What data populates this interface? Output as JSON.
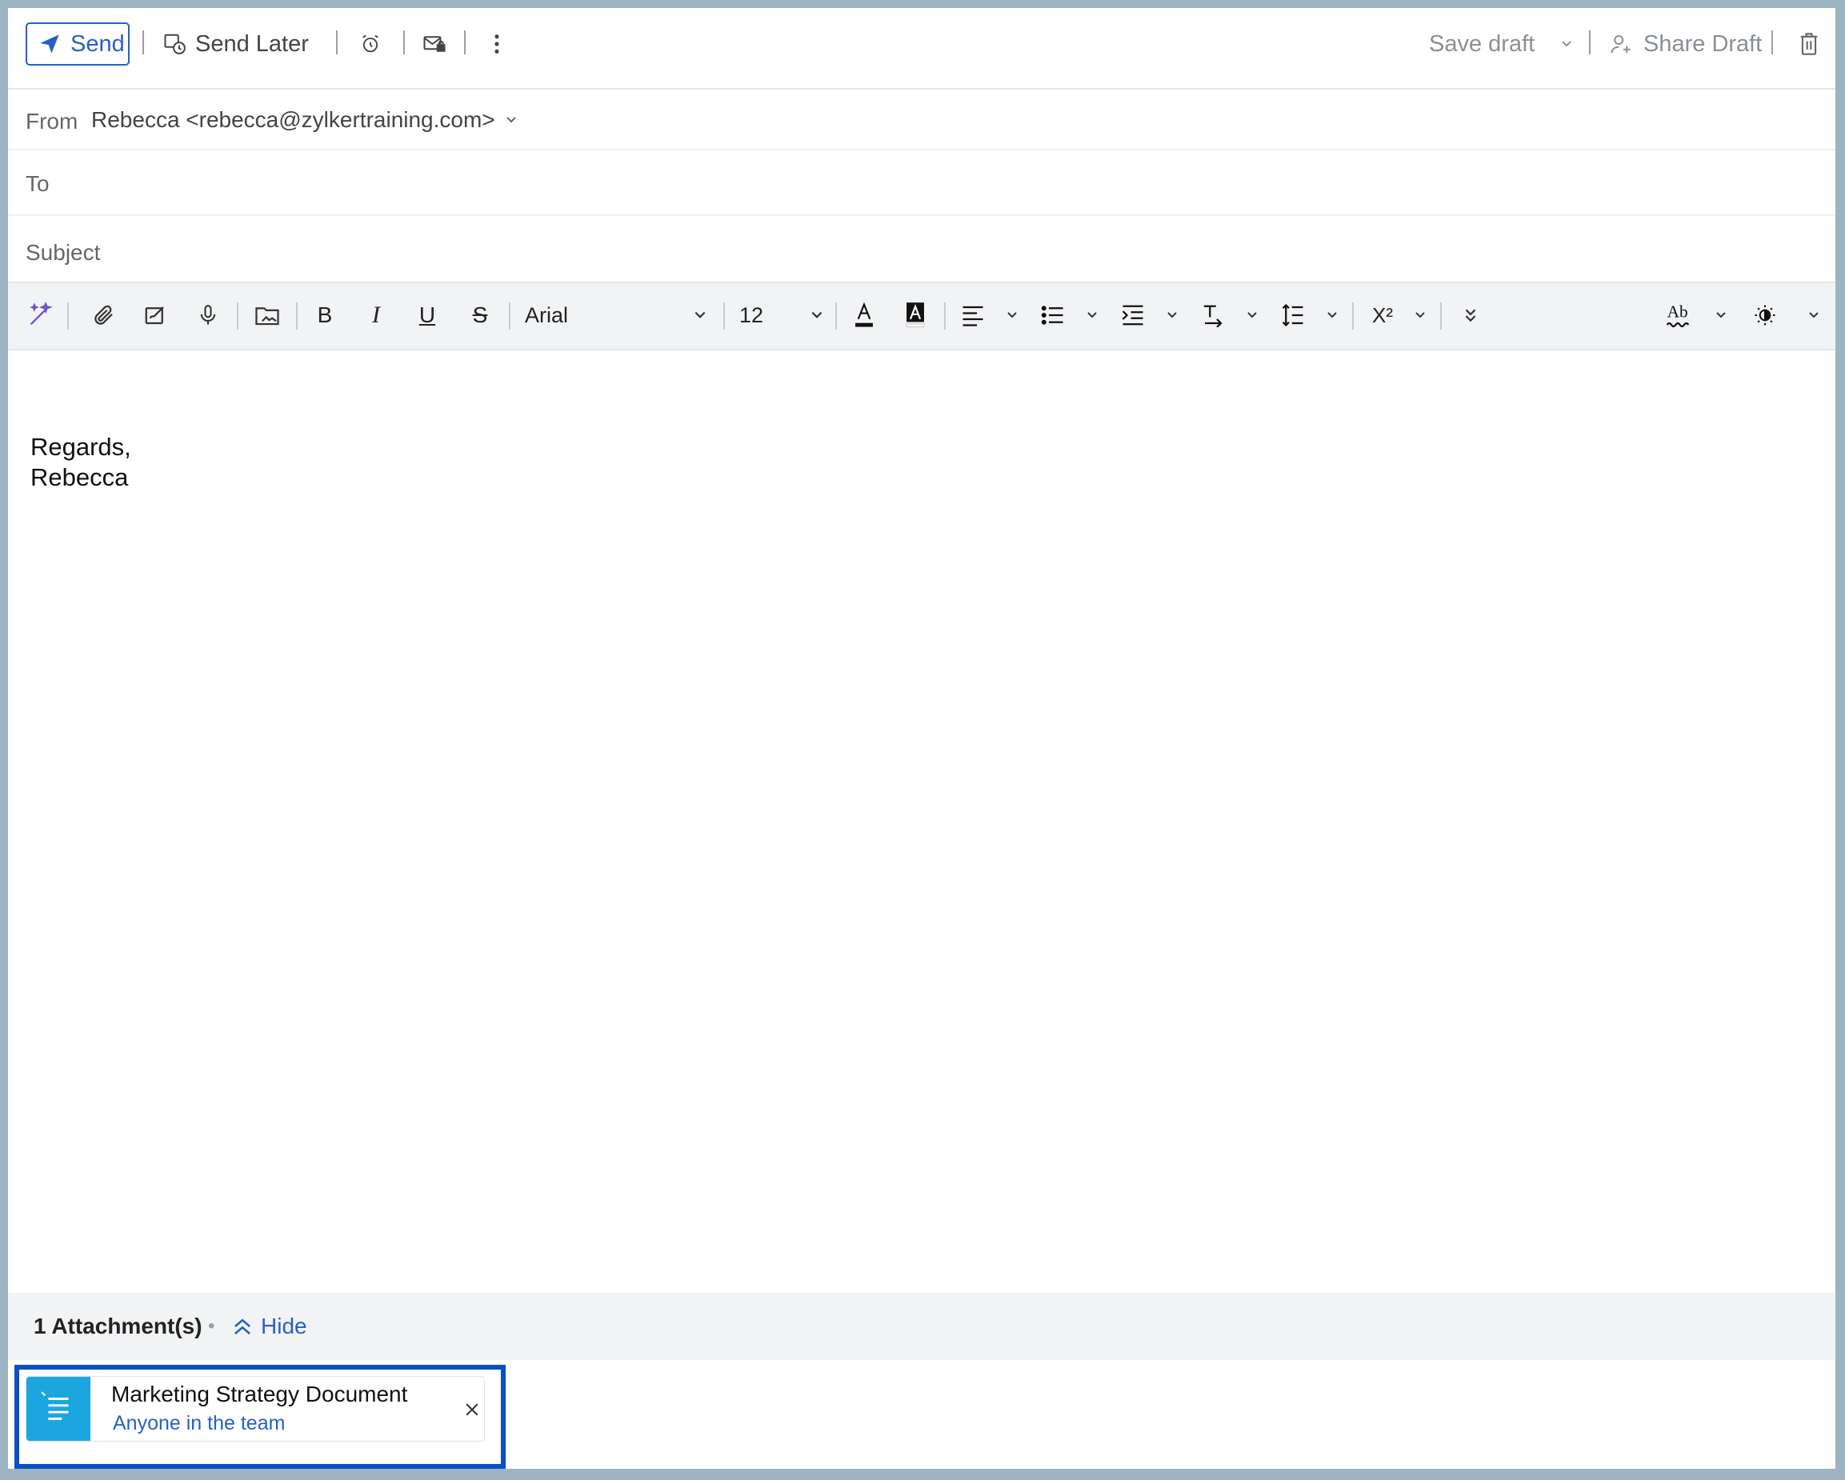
{
  "toolbar": {
    "send_label": "Send",
    "send_later_label": "Send Later",
    "save_draft_label": "Save draft",
    "share_draft_label": "Share Draft"
  },
  "header": {
    "from_label": "From",
    "from_value": "Rebecca <rebecca@zylkertraining.com>",
    "to_label": "To",
    "subject_label": "Subject"
  },
  "format": {
    "font_family": "Arial",
    "font_size": "12"
  },
  "body": {
    "signature_line1": "Regards,",
    "signature_line2": "Rebecca"
  },
  "attachments": {
    "count_label": "1 Attachment(s)",
    "hide_label": "Hide",
    "items": [
      {
        "name": "Marketing Strategy Document",
        "share": "Anyone in the team"
      }
    ]
  },
  "colors": {
    "accent": "#2a5fc4",
    "highlight_border": "#0a4fc4",
    "doc_icon": "#1ba6e0",
    "frame": "#9db5c3"
  }
}
